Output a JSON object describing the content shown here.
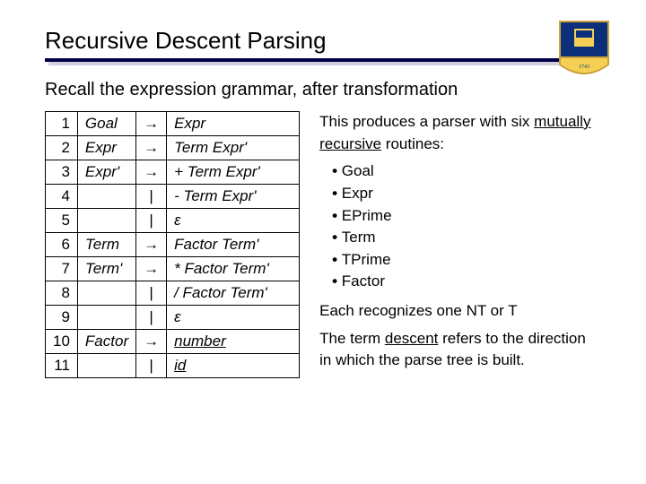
{
  "title": "Recursive Descent Parsing",
  "subtitle": "Recall the expression grammar, after transformation",
  "grammar": {
    "rows": [
      {
        "n": "1",
        "lhs": "Goal",
        "op": "→",
        "rhs": "Expr",
        "u": false
      },
      {
        "n": "2",
        "lhs": "Expr",
        "op": "→",
        "rhs": "Term Expr'",
        "u": false
      },
      {
        "n": "3",
        "lhs": "Expr'",
        "op": "→",
        "rhs": "+ Term Expr'",
        "u": false
      },
      {
        "n": "4",
        "lhs": "",
        "op": "|",
        "rhs": "- Term Expr'",
        "u": false
      },
      {
        "n": "5",
        "lhs": "",
        "op": "|",
        "rhs": "ε",
        "u": false
      },
      {
        "n": "6",
        "lhs": "Term",
        "op": "→",
        "rhs": "Factor Term'",
        "u": false
      },
      {
        "n": "7",
        "lhs": "Term'",
        "op": "→",
        "rhs": "* Factor Term'",
        "u": false
      },
      {
        "n": "8",
        "lhs": "",
        "op": "|",
        "rhs": "/ Factor Term'",
        "u": false
      },
      {
        "n": "9",
        "lhs": "",
        "op": "|",
        "rhs": "ε",
        "u": false
      },
      {
        "n": "10",
        "lhs": "Factor",
        "op": "→",
        "rhs": "number",
        "u": true
      },
      {
        "n": "11",
        "lhs": "",
        "op": "|",
        "rhs": "id",
        "u": true
      }
    ]
  },
  "notes": {
    "intro_a": "This produces a parser with six ",
    "intro_b_underlined": "mutually recursive",
    "intro_c": " routines:",
    "routines": [
      "Goal",
      "Expr",
      "EPrime",
      "Term",
      "TPrime",
      "Factor"
    ],
    "line2": "Each recognizes one NT or T",
    "line3_a": "The term ",
    "line3_b_underlined": "descent",
    "line3_c": " refers to the direction in which the parse tree is built."
  }
}
